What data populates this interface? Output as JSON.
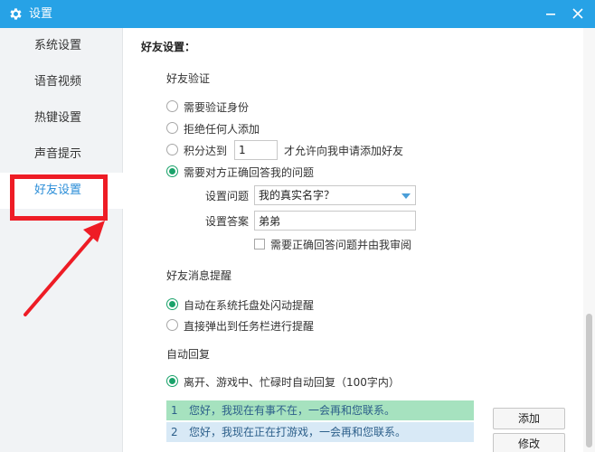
{
  "window": {
    "title": "设置"
  },
  "sidebar": {
    "items": [
      {
        "label": "系统设置"
      },
      {
        "label": "语音视频"
      },
      {
        "label": "热键设置"
      },
      {
        "label": "声音提示"
      },
      {
        "label": "好友设置"
      }
    ],
    "active_index": 4
  },
  "friend_settings": {
    "section_title": "好友设置：",
    "verification": {
      "title": "好友验证",
      "option_need_verify": "需要验证身份",
      "option_reject_all": "拒绝任何人添加",
      "option_points_prefix": "积分达到",
      "points_value": "1",
      "option_points_suffix": "才允许向我申请添加好友",
      "option_question": "需要对方正确回答我的问题",
      "question_label": "设置问题",
      "question_value": "我的真实名字？",
      "answer_label": "设置答案",
      "answer_value": "弟弟",
      "review_label": "需要正确回答问题并由我审阅"
    },
    "message_reminder": {
      "title": "好友消息提醒",
      "option_tray_flash": "自动在系统托盘处闪动提醒",
      "option_taskbar_popup": "直接弹出到任务栏进行提醒"
    },
    "auto_reply": {
      "title": "自动回复",
      "option_label": "离开、游戏中、忙碌时自动回复（100字内）",
      "replies": [
        {
          "num": "1",
          "text": "您好，我现在有事不在，一会再和您联系。"
        },
        {
          "num": "2",
          "text": "您好，我现在正在打游戏，一会再和您联系。"
        }
      ],
      "add_button": "添加",
      "edit_button": "修改"
    }
  },
  "colors": {
    "titlebar": "#27a2e6",
    "accent": "#1aa26a",
    "annotation": "#ee1c25"
  }
}
